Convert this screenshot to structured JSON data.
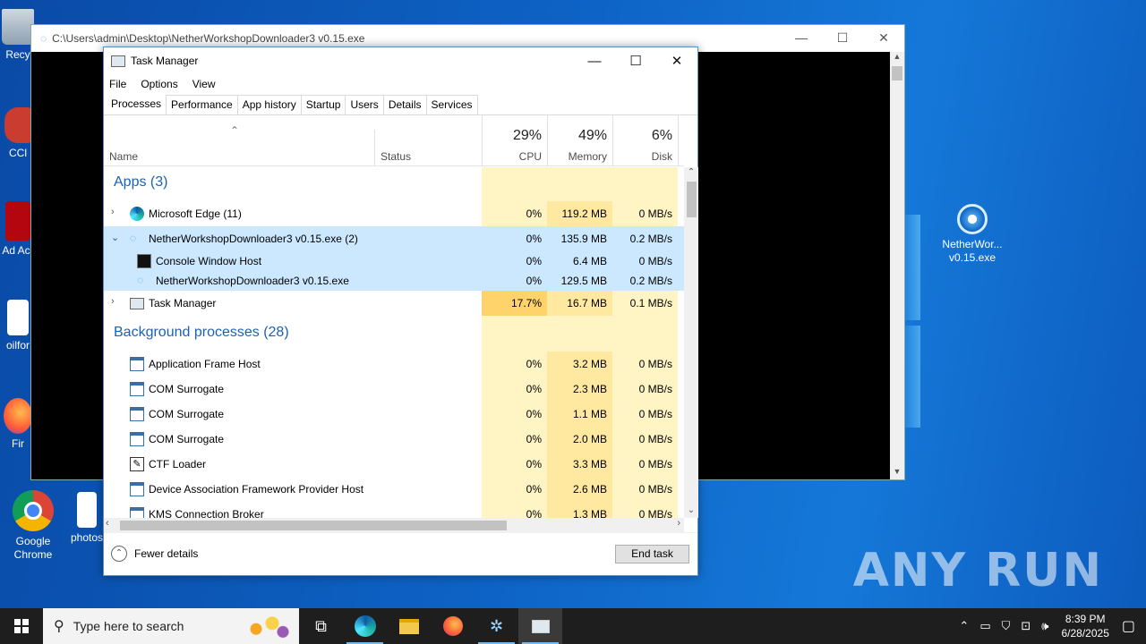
{
  "desktop": {
    "icons": [
      {
        "label": "Recy",
        "name": "recycle-bin"
      },
      {
        "label": "CCl",
        "name": "ccleaner"
      },
      {
        "label": "Ad Acr",
        "name": "adobe-acrobat"
      },
      {
        "label": "oilfor",
        "name": "oilfor-file"
      },
      {
        "label": "Fir",
        "name": "firefox"
      },
      {
        "label": "Google Chrome",
        "name": "google-chrome"
      },
      {
        "label": "photos",
        "name": "photos"
      },
      {
        "label": "NetherWor... v0.15.exe",
        "name": "netherworkshop-exe"
      }
    ],
    "watermark": "ANY RUN"
  },
  "console": {
    "title": "C:\\Users\\admin\\Desktop\\NetherWorkshopDownloader3 v0.15.exe"
  },
  "taskmanager": {
    "title": "Task Manager",
    "menu": [
      "File",
      "Options",
      "View"
    ],
    "tabs": [
      "Processes",
      "Performance",
      "App history",
      "Startup",
      "Users",
      "Details",
      "Services"
    ],
    "active_tab": "Processes",
    "columns": {
      "name": "Name",
      "status": "Status",
      "cpu_pct": "29%",
      "cpu": "CPU",
      "mem_pct": "49%",
      "mem": "Memory",
      "disk_pct": "6%",
      "disk": "Disk"
    },
    "groups": {
      "apps": "Apps (3)",
      "background": "Background processes (28)"
    },
    "rows": [
      {
        "name": "Microsoft Edge (11)",
        "cpu": "0%",
        "mem": "119.2 MB",
        "disk": "0 MB/s",
        "expander": ">"
      },
      {
        "name": "NetherWorkshopDownloader3 v0.15.exe (2)",
        "cpu": "0%",
        "mem": "135.9 MB",
        "disk": "0.2 MB/s",
        "expander": "v"
      },
      {
        "name": "Console Window Host",
        "cpu": "0%",
        "mem": "6.4 MB",
        "disk": "0 MB/s"
      },
      {
        "name": "NetherWorkshopDownloader3 v0.15.exe",
        "cpu": "0%",
        "mem": "129.5 MB",
        "disk": "0.2 MB/s"
      },
      {
        "name": "Task Manager",
        "cpu": "17.7%",
        "mem": "16.7 MB",
        "disk": "0.1 MB/s",
        "expander": ">"
      },
      {
        "name": "Application Frame Host",
        "cpu": "0%",
        "mem": "3.2 MB",
        "disk": "0 MB/s"
      },
      {
        "name": "COM Surrogate",
        "cpu": "0%",
        "mem": "2.3 MB",
        "disk": "0 MB/s"
      },
      {
        "name": "COM Surrogate",
        "cpu": "0%",
        "mem": "1.1 MB",
        "disk": "0 MB/s"
      },
      {
        "name": "COM Surrogate",
        "cpu": "0%",
        "mem": "2.0 MB",
        "disk": "0 MB/s"
      },
      {
        "name": "CTF Loader",
        "cpu": "0%",
        "mem": "3.3 MB",
        "disk": "0 MB/s"
      },
      {
        "name": "Device Association Framework Provider Host",
        "cpu": "0%",
        "mem": "2.6 MB",
        "disk": "0 MB/s"
      },
      {
        "name": "KMS Connection Broker",
        "cpu": "0%",
        "mem": "1.3 MB",
        "disk": "0 MB/s"
      }
    ],
    "fewer_details": "Fewer details",
    "end_task": "End task"
  },
  "taskbar": {
    "search_placeholder": "Type here to search",
    "time": "8:39 PM",
    "date": "6/28/2025"
  }
}
